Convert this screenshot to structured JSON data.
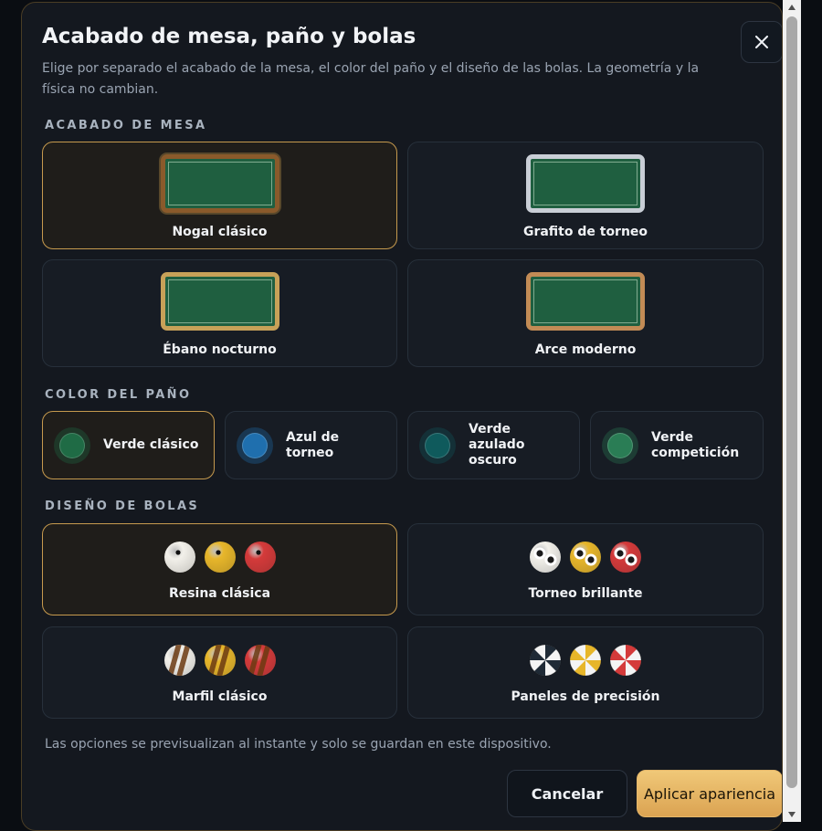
{
  "dialog": {
    "title": "Acabado de mesa, paño y bolas",
    "description": "Elige por separado el acabado de la mesa, el color del paño y el diseño de las bolas. La geometría y la física no cambian.",
    "close_icon": "close-icon"
  },
  "table_finish": {
    "heading": "ACABADO DE MESA",
    "options": [
      {
        "label": "Nogal clásico",
        "selected": true,
        "frame_color": "#8a5a2b",
        "felt_color": "#1f5f40"
      },
      {
        "label": "Grafito de torneo",
        "selected": false,
        "frame_color": "#c9ced6",
        "felt_color": "#1f5f40"
      },
      {
        "label": "Ébano nocturno",
        "selected": false,
        "frame_color": "#c7a158",
        "felt_color": "#1f5f40"
      },
      {
        "label": "Arce moderno",
        "selected": false,
        "frame_color": "#c28b55",
        "felt_color": "#1f5f40"
      }
    ]
  },
  "cloth_color": {
    "heading": "COLOR DEL PAÑO",
    "options": [
      {
        "label": "Verde clásico",
        "selected": true,
        "color": "#1f6b45"
      },
      {
        "label": "Azul de torneo",
        "selected": false,
        "color": "#1f6fae"
      },
      {
        "label": "Verde azulado oscuro",
        "selected": false,
        "color": "#0f5a5c"
      },
      {
        "label": "Verde competición",
        "selected": false,
        "color": "#2a7d55"
      }
    ]
  },
  "ball_design": {
    "heading": "DISEÑO DE BOLAS",
    "options": [
      {
        "label": "Resina clásica",
        "selected": true,
        "style": "solid"
      },
      {
        "label": "Torneo brillante",
        "selected": false,
        "style": "spots"
      },
      {
        "label": "Marfil clásico",
        "selected": false,
        "style": "stripes"
      },
      {
        "label": "Paneles de precisión",
        "selected": false,
        "style": "panels"
      }
    ],
    "ball_colors": [
      "#f2f0ea",
      "#e7b62a",
      "#d43a3a"
    ]
  },
  "footer": {
    "note": "Las opciones se previsualizan al instante y solo se guardan en este dispositivo.",
    "cancel_label": "Cancelar",
    "apply_label": "Aplicar apariencia"
  },
  "colors": {
    "accent": "#c69a4e",
    "apply_button": "#e9b968",
    "panel": "#14181f"
  }
}
